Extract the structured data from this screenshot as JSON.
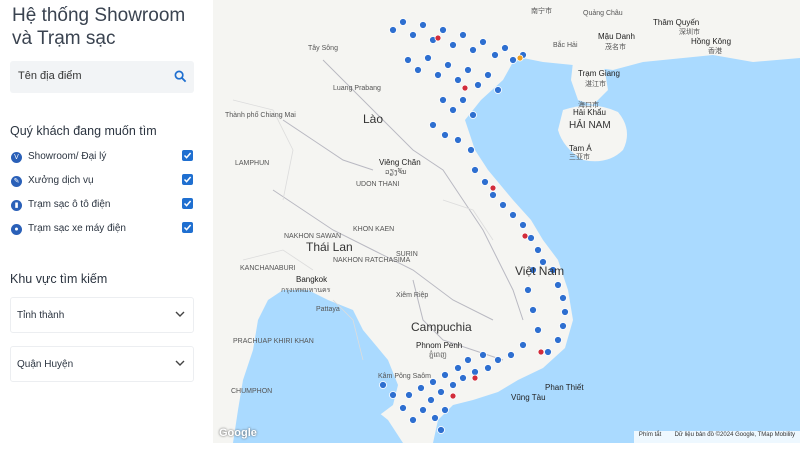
{
  "sidebar": {
    "title_line1": "Hệ thống Showroom",
    "title_line2": "và Trạm sạc",
    "search": {
      "placeholder": "Tên địa điểm",
      "icon": "search-icon"
    },
    "filters_heading": "Quý khách đang muốn tìm",
    "filters": [
      {
        "label": "Showroom/ Đại lý",
        "icon": "V",
        "checked": true
      },
      {
        "label": "Xưởng dịch vụ",
        "icon": "wrench",
        "checked": true
      },
      {
        "label": "Trạm sạc ô tô điện",
        "icon": "charger",
        "checked": true
      },
      {
        "label": "Trạm sạc xe máy điện",
        "icon": "scooter",
        "checked": true
      }
    ],
    "area_heading": "Khu vực tìm kiếm",
    "province_dropdown": "Tỉnh thành",
    "district_dropdown": "Quận Huyện"
  },
  "map": {
    "labels": {
      "laos": "Lào",
      "thailand": "Thái Lan",
      "cambodia": "Campuchia",
      "vietnam": "Việt Nam",
      "vientiane": "Viêng Chăn",
      "vientiane_local": "ວຽງຈັນ",
      "bangkok": "Bangkok",
      "bangkok_local": "กรุงเทพมหานคร",
      "phnom_penh": "Phnom Penh",
      "phnom_penh_local": "ភ្នំពេញ",
      "hai_nam": "HẢI NAM",
      "hai_khau": "Hải Khẩu",
      "hai_khau_local": "海口市",
      "tam_a": "Tam Á",
      "tam_a_local": "三亚市",
      "tram_giang": "Trạm Giang",
      "tram_giang_local": "湛江市",
      "bac_hai": "Bắc Hải",
      "nam_ninh": "南宁市",
      "mau_danh": "Mậu Danh",
      "mau_danh_local": "茂名市",
      "tham_quyen": "Thâm Quyến",
      "tham_quyen_local": "深圳市",
      "hong_kong": "Hồng Kông",
      "hong_kong_local": "香港",
      "quang_chau": "Quảng Châu",
      "udon_thani": "UDON THANI",
      "khon_kaen": "KHON KAEN",
      "nakhon_ratchasima": "NAKHON RATCHASIMA",
      "nakhon_sawan": "NAKHON SAWAN",
      "kanchanaburi": "KANCHANABURI",
      "surin": "SURIN",
      "siem_reap": "Xiêm Riệp",
      "pattaya": "Pattaya",
      "prachuap": "PRACHUAP KHIRI KHAN",
      "chumphon": "CHUMPHON",
      "kampong_som": "Kâm Pông Saôm",
      "vung_tau": "Vũng Tàu",
      "phan_thiet": "Phan Thiết",
      "lamphun": "LAMPHUN",
      "chiang_mai": "Thành phố Chiang Mai",
      "tay_song": "Tây Sông",
      "luang_prabang": "Luang Prabang"
    },
    "google_logo": "Google",
    "attribution_shortcuts": "Phím tắt",
    "attribution_data": "Dữ liệu bản đồ ©2024 Google, TMap Mobility"
  }
}
